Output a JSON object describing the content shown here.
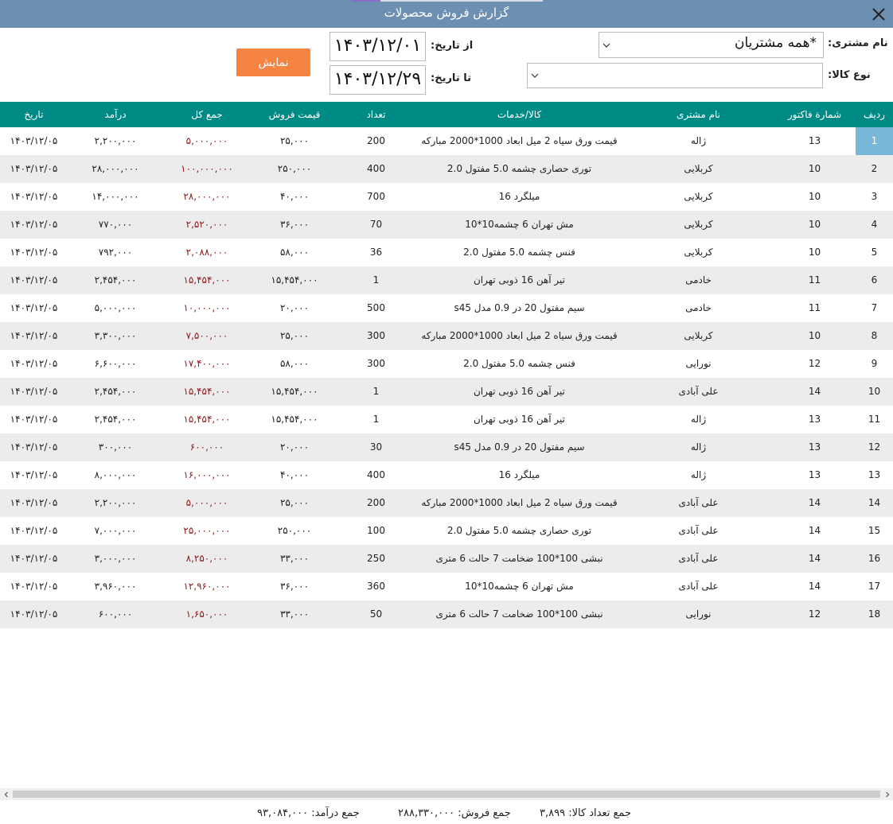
{
  "window": {
    "title": "گزارش فروش محصولات"
  },
  "filters": {
    "customer_label": "نام مشتری:",
    "customer_value": "*همه مشتریان",
    "item_type_label": "نوع کالا:",
    "item_type_value": "",
    "from_label": "از تاریخ:",
    "from_value": "۱۴۰۳/۱۲/۰۱",
    "to_label": "تا تاریخ:",
    "to_value": "۱۴۰۳/۱۲/۲۹",
    "show_button": "نمایش"
  },
  "table": {
    "headers": {
      "row": "ردیف",
      "invoice": "شمارة فاکتور",
      "customer": "نام مشتری",
      "item": "کالا/خدمات",
      "qty": "تعداد",
      "price": "قیمت فروش",
      "total": "جمع کل",
      "revenue": "درآمد",
      "date": "تاریخ"
    },
    "rows": [
      {
        "row": "1",
        "invoice": "13",
        "customer": "ژاله",
        "item": "قیمت ورق سیاه 2 میل ابعاد 1000*2000 مبارکه",
        "qty": "200",
        "price": "۲۵,۰۰۰",
        "total": "۵,۰۰۰,۰۰۰",
        "revenue": "۲,۲۰۰,۰۰۰",
        "date": "۱۴۰۳/۱۲/۰۵"
      },
      {
        "row": "2",
        "invoice": "10",
        "customer": "کربلایی",
        "item": "توری حصاری چشمه 5.0 مفتول 2.0",
        "qty": "400",
        "price": "۲۵۰,۰۰۰",
        "total": "۱۰۰,۰۰۰,۰۰۰",
        "revenue": "۲۸,۰۰۰,۰۰۰",
        "date": "۱۴۰۳/۱۲/۰۵"
      },
      {
        "row": "3",
        "invoice": "10",
        "customer": "کربلایی",
        "item": "میلگرد 16",
        "qty": "700",
        "price": "۴۰,۰۰۰",
        "total": "۲۸,۰۰۰,۰۰۰",
        "revenue": "۱۴,۰۰۰,۰۰۰",
        "date": "۱۴۰۳/۱۲/۰۵"
      },
      {
        "row": "4",
        "invoice": "10",
        "customer": "کربلایی",
        "item": "مش تهران 6  چشمه10*10",
        "qty": "70",
        "price": "۳۶,۰۰۰",
        "total": "۲,۵۲۰,۰۰۰",
        "revenue": "۷۷۰,۰۰۰",
        "date": "۱۴۰۳/۱۲/۰۵"
      },
      {
        "row": "5",
        "invoice": "10",
        "customer": "کربلایی",
        "item": "فنس چشمه 5.0 مفتول 2.0",
        "qty": "36",
        "price": "۵۸,۰۰۰",
        "total": "۲,۰۸۸,۰۰۰",
        "revenue": "۷۹۲,۰۰۰",
        "date": "۱۴۰۳/۱۲/۰۵"
      },
      {
        "row": "6",
        "invoice": "11",
        "customer": "خادمی",
        "item": "تیر آهن 16 ذوبی تهران",
        "qty": "1",
        "price": "۱۵,۴۵۴,۰۰۰",
        "total": "۱۵,۴۵۴,۰۰۰",
        "revenue": "۲,۴۵۴,۰۰۰",
        "date": "۱۴۰۳/۱۲/۰۵"
      },
      {
        "row": "7",
        "invoice": "11",
        "customer": "خادمی",
        "item": "سیم مفتول 20 در 0.9 مدل s45",
        "qty": "500",
        "price": "۲۰,۰۰۰",
        "total": "۱۰,۰۰۰,۰۰۰",
        "revenue": "۵,۰۰۰,۰۰۰",
        "date": "۱۴۰۳/۱۲/۰۵"
      },
      {
        "row": "8",
        "invoice": "10",
        "customer": "کربلایی",
        "item": "قیمت ورق سیاه 2 میل ابعاد 1000*2000 مبارکه",
        "qty": "300",
        "price": "۲۵,۰۰۰",
        "total": "۷,۵۰۰,۰۰۰",
        "revenue": "۳,۳۰۰,۰۰۰",
        "date": "۱۴۰۳/۱۲/۰۵"
      },
      {
        "row": "9",
        "invoice": "12",
        "customer": "نورایی",
        "item": "فنس چشمه 5.0 مفتول 2.0",
        "qty": "300",
        "price": "۵۸,۰۰۰",
        "total": "۱۷,۴۰۰,۰۰۰",
        "revenue": "۶,۶۰۰,۰۰۰",
        "date": "۱۴۰۳/۱۲/۰۵"
      },
      {
        "row": "10",
        "invoice": "14",
        "customer": "علی آبادی",
        "item": "تیر آهن 16 ذوبی تهران",
        "qty": "1",
        "price": "۱۵,۴۵۴,۰۰۰",
        "total": "۱۵,۴۵۴,۰۰۰",
        "revenue": "۲,۴۵۴,۰۰۰",
        "date": "۱۴۰۳/۱۲/۰۵"
      },
      {
        "row": "11",
        "invoice": "13",
        "customer": "ژاله",
        "item": "تیر آهن 16 ذوبی تهران",
        "qty": "1",
        "price": "۱۵,۴۵۴,۰۰۰",
        "total": "۱۵,۴۵۴,۰۰۰",
        "revenue": "۲,۴۵۴,۰۰۰",
        "date": "۱۴۰۳/۱۲/۰۵"
      },
      {
        "row": "12",
        "invoice": "13",
        "customer": "ژاله",
        "item": "سیم مفتول 20 در 0.9 مدل s45",
        "qty": "30",
        "price": "۲۰,۰۰۰",
        "total": "۶۰۰,۰۰۰",
        "revenue": "۳۰۰,۰۰۰",
        "date": "۱۴۰۳/۱۲/۰۵"
      },
      {
        "row": "13",
        "invoice": "13",
        "customer": "ژاله",
        "item": "میلگرد 16",
        "qty": "400",
        "price": "۴۰,۰۰۰",
        "total": "۱۶,۰۰۰,۰۰۰",
        "revenue": "۸,۰۰۰,۰۰۰",
        "date": "۱۴۰۳/۱۲/۰۵"
      },
      {
        "row": "14",
        "invoice": "14",
        "customer": "علی آبادی",
        "item": "قیمت ورق سیاه 2 میل ابعاد 1000*2000 مبارکه",
        "qty": "200",
        "price": "۲۵,۰۰۰",
        "total": "۵,۰۰۰,۰۰۰",
        "revenue": "۲,۲۰۰,۰۰۰",
        "date": "۱۴۰۳/۱۲/۰۵"
      },
      {
        "row": "15",
        "invoice": "14",
        "customer": "علی آبادی",
        "item": "توری حصاری چشمه 5.0 مفتول 2.0",
        "qty": "100",
        "price": "۲۵۰,۰۰۰",
        "total": "۲۵,۰۰۰,۰۰۰",
        "revenue": "۷,۰۰۰,۰۰۰",
        "date": "۱۴۰۳/۱۲/۰۵"
      },
      {
        "row": "16",
        "invoice": "14",
        "customer": "علی آبادی",
        "item": "نبشی 100*100 ضخامت 7 حالت 6 متری",
        "qty": "250",
        "price": "۳۳,۰۰۰",
        "total": "۸,۲۵۰,۰۰۰",
        "revenue": "۳,۰۰۰,۰۰۰",
        "date": "۱۴۰۳/۱۲/۰۵"
      },
      {
        "row": "17",
        "invoice": "14",
        "customer": "علی آبادی",
        "item": "مش تهران 6  چشمه10*10",
        "qty": "360",
        "price": "۳۶,۰۰۰",
        "total": "۱۲,۹۶۰,۰۰۰",
        "revenue": "۳,۹۶۰,۰۰۰",
        "date": "۱۴۰۳/۱۲/۰۵"
      },
      {
        "row": "18",
        "invoice": "12",
        "customer": "نورایی",
        "item": "نبشی 100*100 ضخامت 7 حالت 6 متری",
        "qty": "50",
        "price": "۳۳,۰۰۰",
        "total": "۱,۶۵۰,۰۰۰",
        "revenue": "۶۰۰,۰۰۰",
        "date": "۱۴۰۳/۱۲/۰۵"
      }
    ]
  },
  "footer": {
    "qty_sum": "جمع تعداد کالا: ۳,۸۹۹",
    "sales_sum": "جمع فروش: ۲۸۸,۳۳۰,۰۰۰",
    "revenue_sum": "جمع درآمد: ۹۳,۰۸۴,۰۰۰"
  },
  "colors": {
    "titlebar": "#6d8fb2",
    "header": "#008a85",
    "accent_button": "#f58342",
    "total_text": "#8b1a1a",
    "selected_row_cell": "#7ab8d9"
  }
}
